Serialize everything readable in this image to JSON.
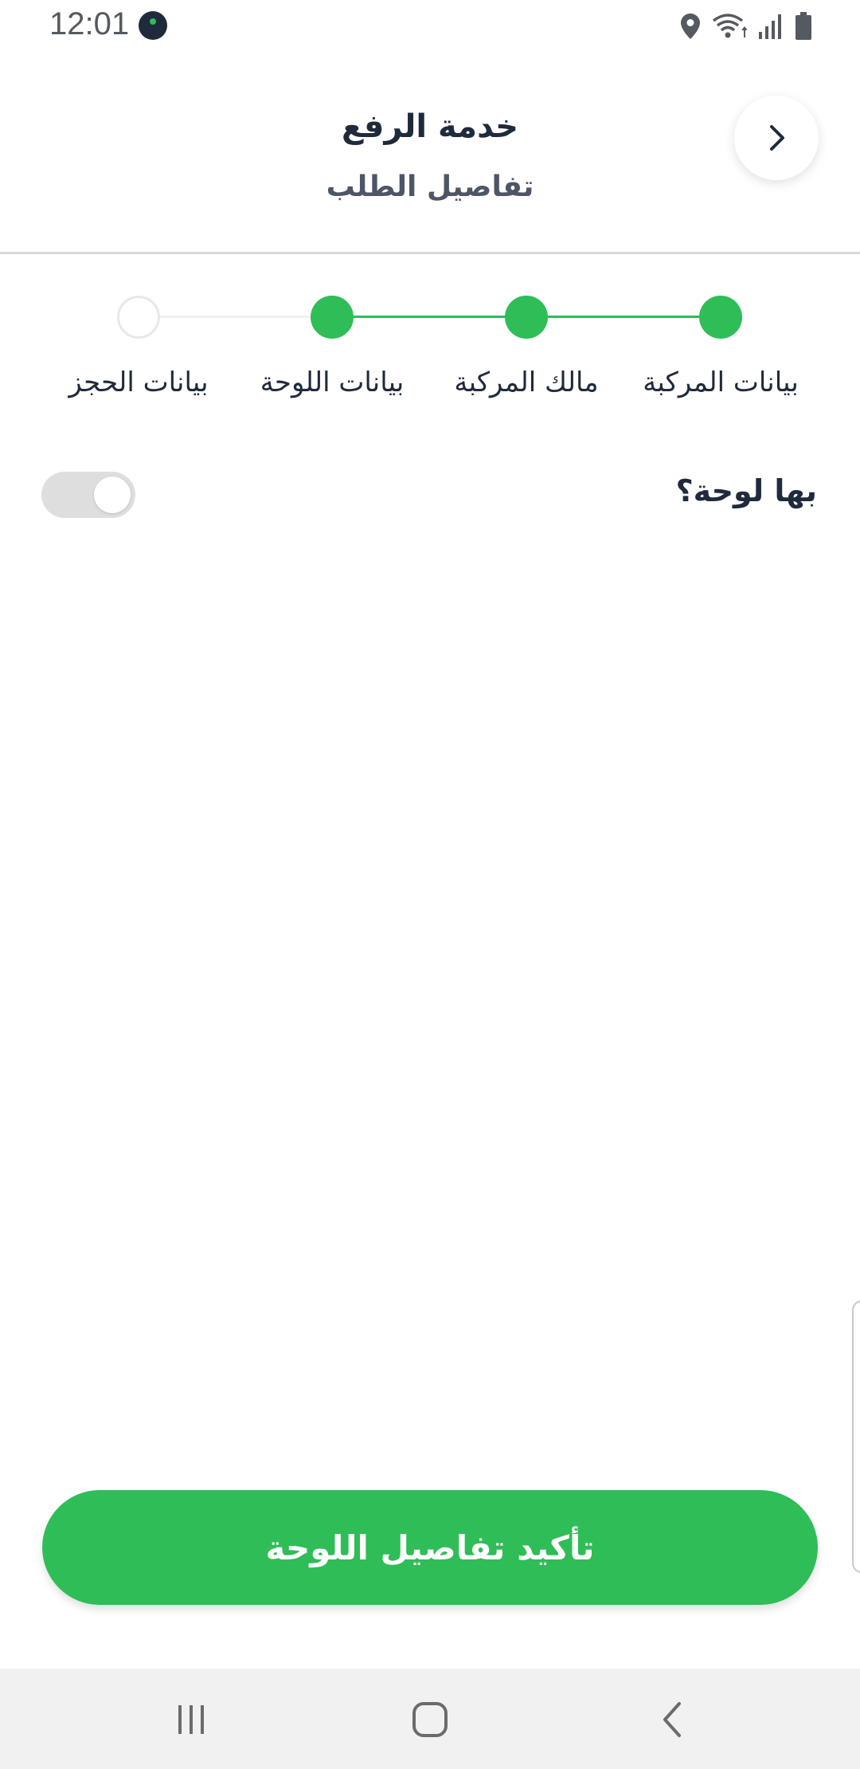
{
  "status_bar": {
    "time": "12:01",
    "icons": [
      "location-icon",
      "wifi-icon",
      "signal-icon",
      "battery-icon"
    ]
  },
  "header": {
    "title": "خدمة الرفع",
    "subtitle": "تفاصيل الطلب",
    "back_icon": "chevron-right-icon"
  },
  "stepper": {
    "steps": [
      {
        "label": "بيانات المركبة",
        "status": "done"
      },
      {
        "label": "مالك المركبة",
        "status": "done"
      },
      {
        "label": "بيانات اللوحة",
        "status": "done"
      },
      {
        "label": "بيانات الحجز",
        "status": "pending"
      }
    ]
  },
  "form": {
    "question": "بها لوحة؟",
    "toggle_on": false
  },
  "confirm_button": {
    "label": "تأكيد تفاصيل اللوحة"
  },
  "nav_bar": {
    "icons": [
      "recent-apps-icon",
      "home-icon",
      "back-icon"
    ]
  },
  "colors": {
    "accent": "#2fbd57",
    "text_dark": "#1f2a3c",
    "toggle_off": "#dedede",
    "nav_bg": "#f1f1f1"
  }
}
